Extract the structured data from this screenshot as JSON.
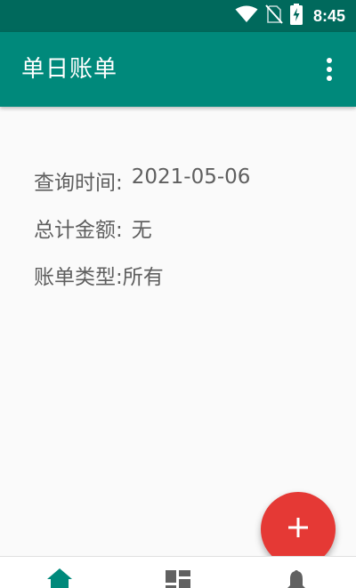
{
  "status_bar": {
    "time": "8:45"
  },
  "app_bar": {
    "title": "单日账单"
  },
  "info": {
    "query_time_label": "查询时间:",
    "query_time_value": "2021-05-06",
    "total_amount_label": "总计金额:",
    "total_amount_value": "无",
    "bill_type_label": "账单类型:",
    "bill_type_value": "所有"
  },
  "fab": {
    "icon": "add-icon"
  },
  "bottom_nav": {
    "items": [
      {
        "icon": "home-icon"
      },
      {
        "icon": "dashboard-icon"
      },
      {
        "icon": "notifications-icon"
      }
    ]
  },
  "colors": {
    "status_bar": "#00695c",
    "primary": "#00897b",
    "fab": "#e53935",
    "nav_active": "#00897b",
    "nav_inactive": "#616161"
  }
}
